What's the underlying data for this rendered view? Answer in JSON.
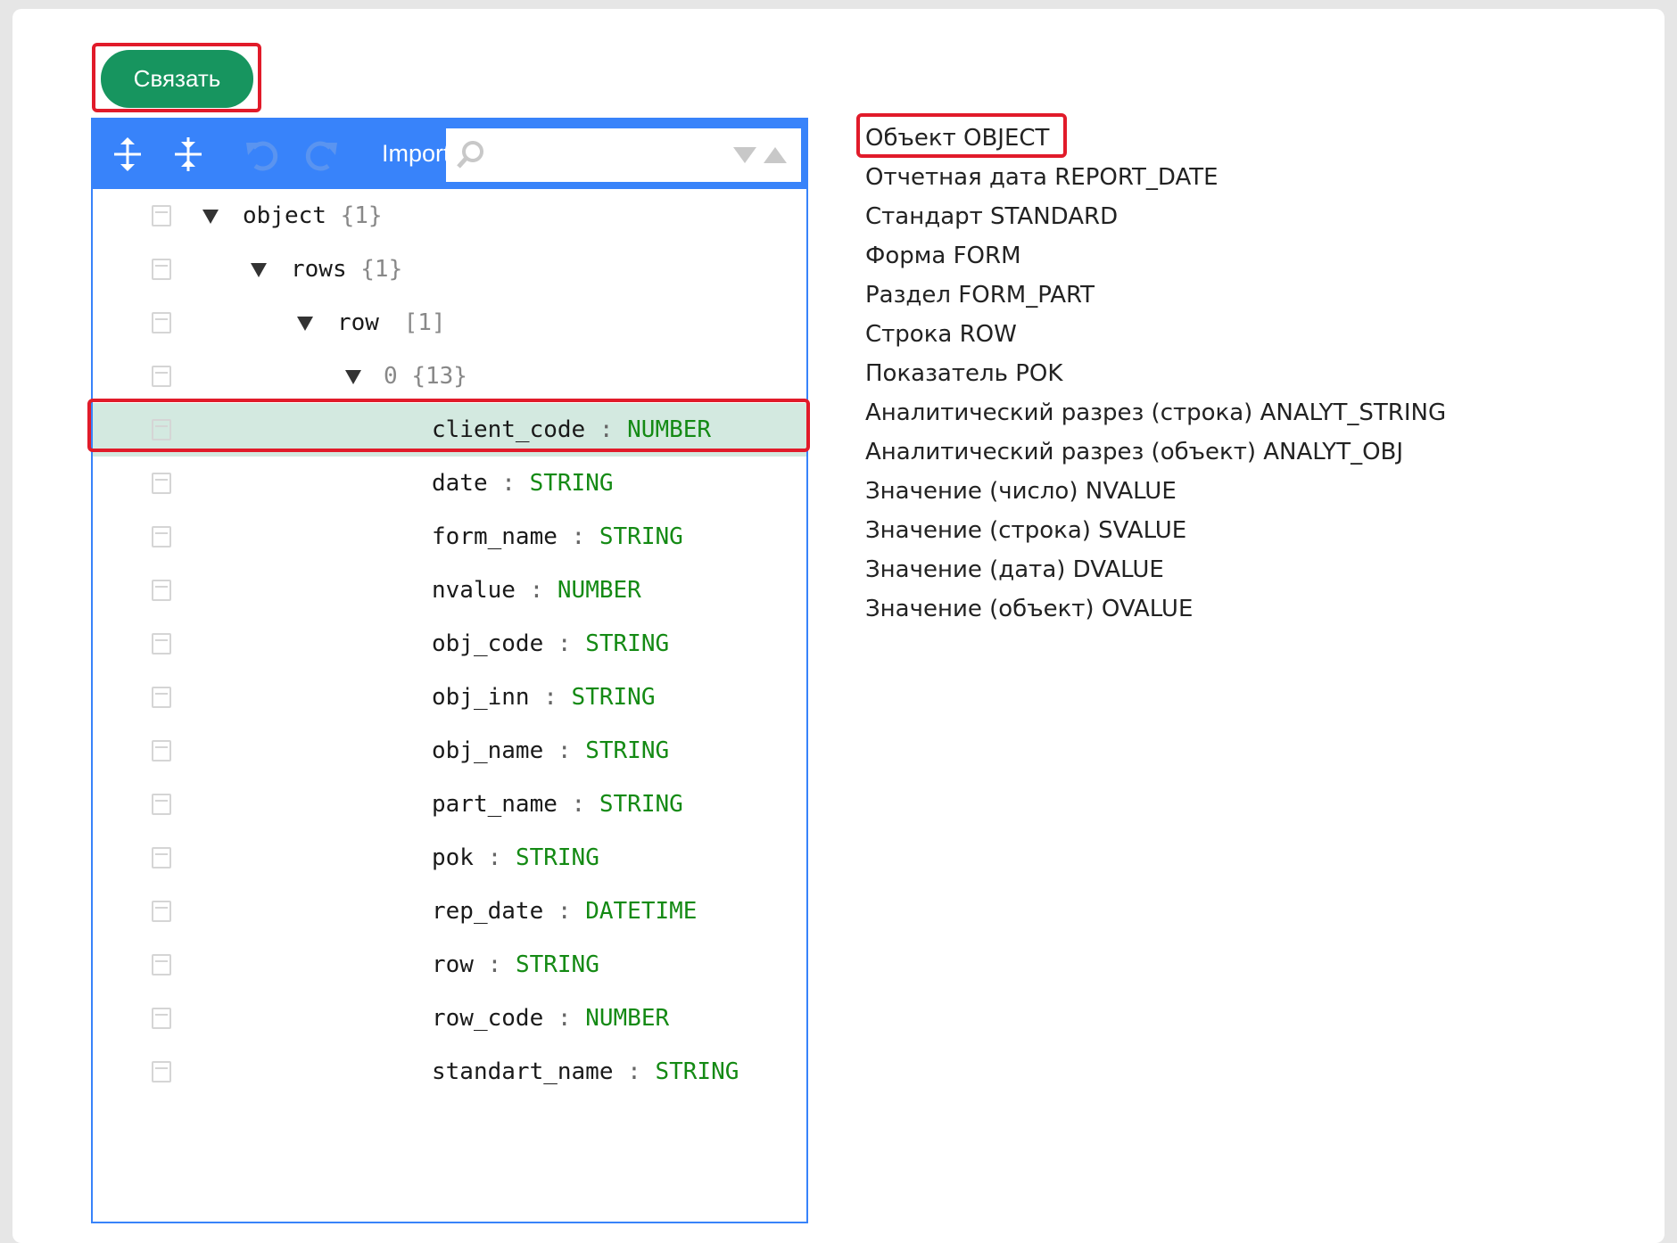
{
  "toolbar": {
    "link_label": "Связать"
  },
  "editor": {
    "menu": {
      "expand_all_icon": "expand-all-icon",
      "collapse_all_icon": "collapse-all-icon",
      "undo_icon": "undo-icon",
      "redo_icon": "redo-icon",
      "mode_label": "Import",
      "search_value": ""
    },
    "tree": {
      "object": {
        "key": "object",
        "count": "{1}"
      },
      "rows": {
        "key": "rows",
        "count": "{1}"
      },
      "row": {
        "key": "row",
        "count": "[1]"
      },
      "zero": {
        "key": "0",
        "count": "{13}"
      },
      "fields": [
        {
          "key": "client_code",
          "type": "NUMBER"
        },
        {
          "key": "date",
          "type": "STRING"
        },
        {
          "key": "form_name",
          "type": "STRING"
        },
        {
          "key": "nvalue",
          "type": "NUMBER"
        },
        {
          "key": "obj_code",
          "type": "STRING"
        },
        {
          "key": "obj_inn",
          "type": "STRING"
        },
        {
          "key": "obj_name",
          "type": "STRING"
        },
        {
          "key": "part_name",
          "type": "STRING"
        },
        {
          "key": "pok ",
          "type": "STRING"
        },
        {
          "key": "rep_date",
          "type": "DATETIME"
        },
        {
          "key": "row ",
          "type": "STRING"
        },
        {
          "key": "row_code",
          "type": "NUMBER"
        },
        {
          "key": "standart_name",
          "type": "STRING"
        }
      ],
      "separator": ":"
    }
  },
  "targets": [
    "Объект OBJECT",
    "Отчетная дата REPORT_DATE",
    "Стандарт STANDARD",
    "Форма FORM",
    "Раздел FORM_PART",
    "Строка ROW",
    "Показатель POK",
    "Аналитический разрез (строка) ANALYT_STRING",
    "Аналитический разрез (объект) ANALYT_OBJ",
    "Значение (число) NVALUE",
    "Значение (строка) SVALUE",
    "Значение (дата) DVALUE",
    "Значение (объект) OVALUE"
  ],
  "colors": {
    "accent": "#17955f",
    "editor_blue": "#3883fa",
    "highlight": "#e11b2a",
    "selected_row": "#d3e9e0",
    "type_green": "#148a14"
  }
}
